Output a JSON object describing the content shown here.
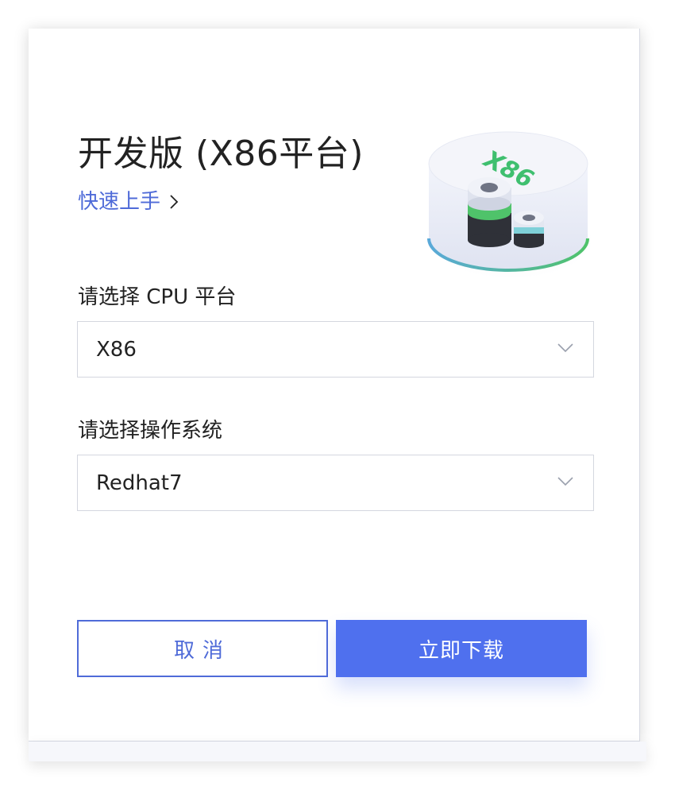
{
  "dialog": {
    "title": "开发版 (X86平台)",
    "quick_start": "快速上手",
    "illustration_label": "X86"
  },
  "cpu_platform": {
    "label": "请选择 CPU 平台",
    "selected": "X86"
  },
  "os": {
    "label": "请选择操作系统",
    "selected": "Redhat7"
  },
  "actions": {
    "cancel": "取消",
    "download": "立即下载"
  },
  "colors": {
    "accent": "#4f70ee",
    "link": "#4f6bd8",
    "green": "#3fbf6f"
  }
}
